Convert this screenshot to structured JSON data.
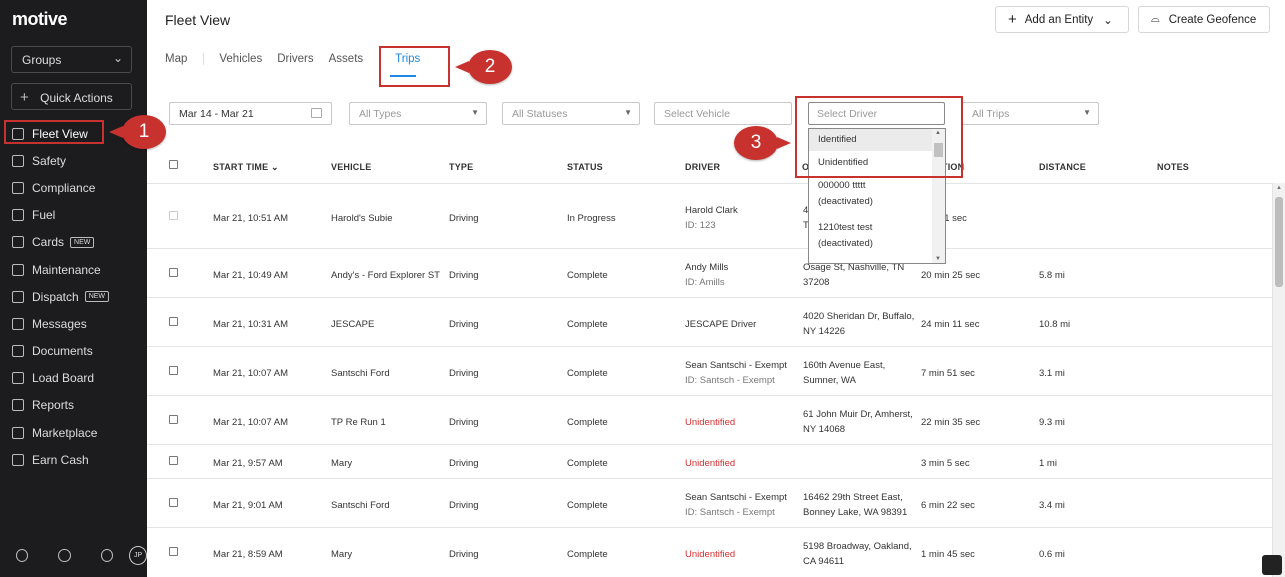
{
  "app": {
    "logo": "motive",
    "groups_label": "Groups",
    "quick_actions": "Quick Actions",
    "avatar": "JP"
  },
  "sidebar": {
    "items": [
      {
        "label": "Fleet View",
        "icon": "map-icon",
        "new": false
      },
      {
        "label": "Safety",
        "icon": "shield-icon",
        "new": false
      },
      {
        "label": "Compliance",
        "icon": "document-icon",
        "new": false
      },
      {
        "label": "Fuel",
        "icon": "fuel-icon",
        "new": false
      },
      {
        "label": "Cards",
        "icon": "card-icon",
        "new": true
      },
      {
        "label": "Maintenance",
        "icon": "wrench-icon",
        "new": false
      },
      {
        "label": "Dispatch",
        "icon": "location-pin-icon",
        "new": true
      },
      {
        "label": "Messages",
        "icon": "chat-icon",
        "new": false
      },
      {
        "label": "Documents",
        "icon": "file-icon",
        "new": false
      },
      {
        "label": "Load Board",
        "icon": "truck-icon",
        "new": false
      },
      {
        "label": "Reports",
        "icon": "chart-icon",
        "new": false
      },
      {
        "label": "Marketplace",
        "icon": "box-icon",
        "new": false
      },
      {
        "label": "Earn Cash",
        "icon": "dollar-icon",
        "new": false
      }
    ],
    "new_badge": "NEW"
  },
  "header": {
    "title": "Fleet View",
    "add_entity": "Add an Entity",
    "create_geofence": "Create Geofence"
  },
  "tabs": [
    "Map",
    "Vehicles",
    "Drivers",
    "Assets",
    "Trips"
  ],
  "filters": {
    "date_range": "Mar 14 - Mar 21",
    "types": "All Types",
    "statuses": "All Statuses",
    "vehicle": "Select Vehicle",
    "driver": "Select Driver",
    "trips": "All Trips"
  },
  "driver_dropdown": {
    "options": [
      {
        "label": "Identified"
      },
      {
        "label": "Unidentified"
      },
      {
        "label": "000000 ttttt",
        "sub": "(deactivated)"
      },
      {
        "label": "1210test test",
        "sub": "(deactivated)"
      }
    ]
  },
  "callouts": [
    "1",
    "2",
    "3"
  ],
  "table": {
    "headers": [
      "START TIME",
      "VEHICLE",
      "TYPE",
      "STATUS",
      "DRIVER",
      "O",
      "TION",
      "DISTANCE",
      "NOTES"
    ],
    "rows": [
      {
        "start": "Mar 21, 10:51 AM",
        "vehicle": "Harold's Subie",
        "type": "Driving",
        "status": "In Progress",
        "driver": "Harold Clark",
        "driver_id": "ID: 123",
        "origin_1": "4",
        "origin_2": "T",
        "duration": "min 51 sec",
        "distance": "",
        "unidentified": false
      },
      {
        "start": "Mar 21, 10:49 AM",
        "vehicle": "Andy's - Ford Explorer ST",
        "type": "Driving",
        "status": "Complete",
        "driver": "Andy Mills",
        "driver_id": "ID: Amills",
        "origin_1": "Osage St, Nashville, TN",
        "origin_2": "37208",
        "duration": "20 min 25 sec",
        "distance": "5.8 mi",
        "unidentified": false
      },
      {
        "start": "Mar 21, 10:31 AM",
        "vehicle": "JESCAPE",
        "type": "Driving",
        "status": "Complete",
        "driver": "JESCAPE Driver",
        "driver_id": "",
        "origin_1": "4020 Sheridan Dr, Buffalo,",
        "origin_2": "NY 14226",
        "duration": "24 min 11 sec",
        "distance": "10.8 mi",
        "unidentified": false
      },
      {
        "start": "Mar 21, 10:07 AM",
        "vehicle": "Santschi Ford",
        "type": "Driving",
        "status": "Complete",
        "driver": "Sean Santschi - Exempt",
        "driver_id": "ID: Santsch - Exempt",
        "origin_1": "160th Avenue East,",
        "origin_2": "Sumner, WA",
        "duration": "7 min 51 sec",
        "distance": "3.1 mi",
        "unidentified": false
      },
      {
        "start": "Mar 21, 10:07 AM",
        "vehicle": "TP Re Run 1",
        "type": "Driving",
        "status": "Complete",
        "driver": "Unidentified",
        "driver_id": "",
        "origin_1": "61 John Muir Dr, Amherst,",
        "origin_2": "NY 14068",
        "duration": "22 min 35 sec",
        "distance": "9.3 mi",
        "unidentified": true
      },
      {
        "start": "Mar 21, 9:57 AM",
        "vehicle": "Mary",
        "type": "Driving",
        "status": "Complete",
        "driver": "Unidentified",
        "driver_id": "",
        "origin_1": "",
        "origin_2": "",
        "duration": "3 min 5 sec",
        "distance": "1 mi",
        "unidentified": true
      },
      {
        "start": "Mar 21, 9:01 AM",
        "vehicle": "Santschi Ford",
        "type": "Driving",
        "status": "Complete",
        "driver": "Sean Santschi - Exempt",
        "driver_id": "ID: Santsch - Exempt",
        "origin_1": "16462 29th Street East,",
        "origin_2": "Bonney Lake, WA 98391",
        "duration": "6 min 22 sec",
        "distance": "3.4 mi",
        "unidentified": false
      },
      {
        "start": "Mar 21, 8:59 AM",
        "vehicle": "Mary",
        "type": "Driving",
        "status": "Complete",
        "driver": "Unidentified",
        "driver_id": "",
        "origin_1": "5198 Broadway, Oakland,",
        "origin_2": "CA 94611",
        "duration": "1 min 45 sec",
        "distance": "0.6 mi",
        "unidentified": true
      }
    ]
  },
  "colors": {
    "sidebar_bg": "#1c1c1e",
    "accent": "#1e88e5",
    "highlight": "#c8322e",
    "unidentified": "#d32f2f"
  }
}
